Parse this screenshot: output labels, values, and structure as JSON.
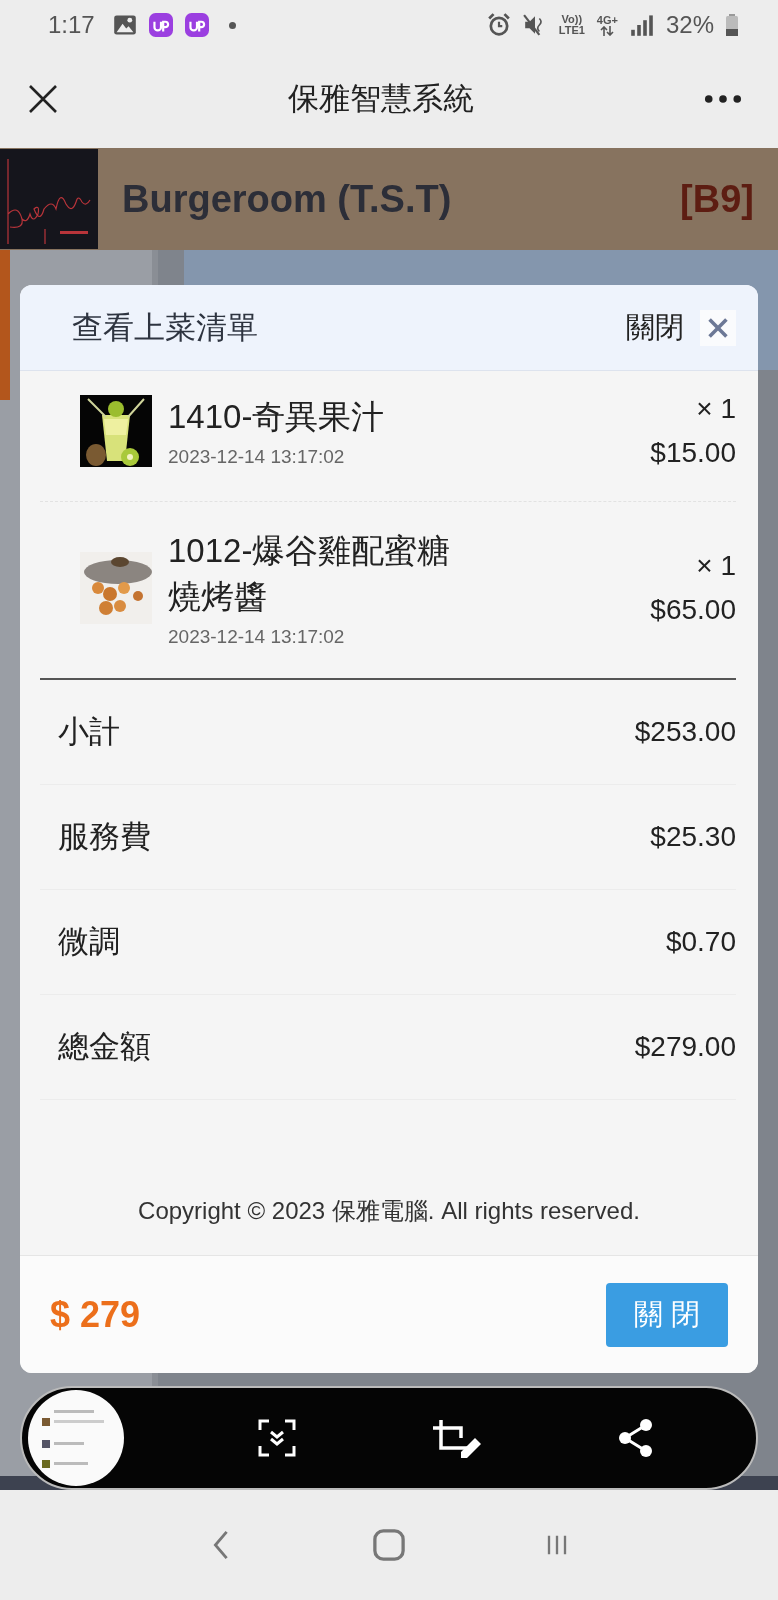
{
  "status_bar": {
    "time": "1:17",
    "volte": "Vo))",
    "lte": "LTE1",
    "network": "4G+",
    "battery": "32%"
  },
  "app_bar": {
    "title": "保雅智慧系統"
  },
  "restaurant": {
    "name": "Burgeroom (T.S.T)",
    "table": "[B9]"
  },
  "dialog": {
    "title": "查看上菜清單",
    "close_label": "關閉",
    "items": [
      {
        "name": "1410-奇異果汁",
        "time": "2023-12-14 13:17:02",
        "qty": "× 1",
        "price": "$15.00",
        "kind": "drink"
      },
      {
        "name": "1012-爆谷雞配蜜糖燒烤醬",
        "time": "2023-12-14 13:17:02",
        "qty": "× 1",
        "price": "$65.00",
        "kind": "food"
      }
    ],
    "summary": [
      {
        "label": "小計",
        "amount": "$253.00"
      },
      {
        "label": "服務費",
        "amount": "$25.30"
      },
      {
        "label": "微調",
        "amount": "$0.70"
      },
      {
        "label": "總金額",
        "amount": "$279.00"
      }
    ],
    "copyright": "Copyright © 2023 保雅電腦. All rights reserved.",
    "total": "$ 279",
    "button": "關 閉"
  }
}
